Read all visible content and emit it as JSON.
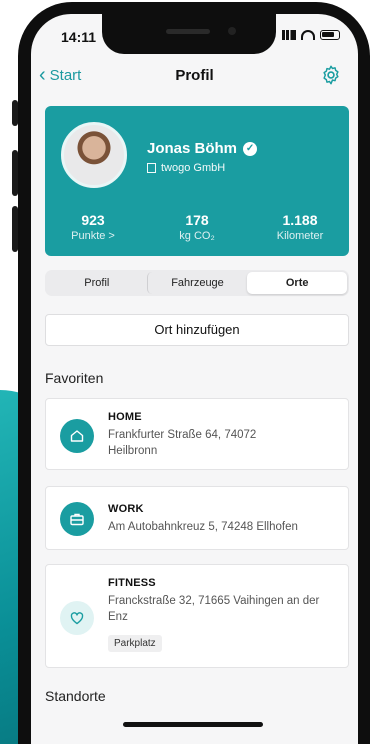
{
  "status": {
    "time": "14:11"
  },
  "nav": {
    "back_label": "Start",
    "title": "Profil"
  },
  "profile": {
    "name": "Jonas Böhm",
    "company": "twogo GmbH",
    "stats": [
      {
        "value": "923",
        "label": "Punkte >"
      },
      {
        "value": "178",
        "label": "kg CO₂"
      },
      {
        "value": "1.188",
        "label": "Kilometer"
      }
    ]
  },
  "tabs": [
    {
      "label": "Profil",
      "active": false
    },
    {
      "label": "Fahrzeuge",
      "active": false
    },
    {
      "label": "Orte",
      "active": true
    }
  ],
  "add_place_label": "Ort hinzufügen",
  "favorites": {
    "title": "Favoriten",
    "items": [
      {
        "title": "HOME",
        "address": "Frankfurter Straße 64, 74072 Heilbronn",
        "icon": "house-icon"
      },
      {
        "title": "WORK",
        "address": "Am Autobahnkreuz 5, 74248 Ellhofen",
        "icon": "briefcase-icon"
      },
      {
        "title": "FITNESS",
        "address": "Franckstraße 32, 71665 Vaihingen an der Enz",
        "icon": "heart-icon",
        "tag": "Parkplatz"
      }
    ]
  },
  "locations": {
    "title": "Standorte"
  },
  "colors": {
    "accent": "#1a9da1",
    "background": "#f6f6f7"
  }
}
